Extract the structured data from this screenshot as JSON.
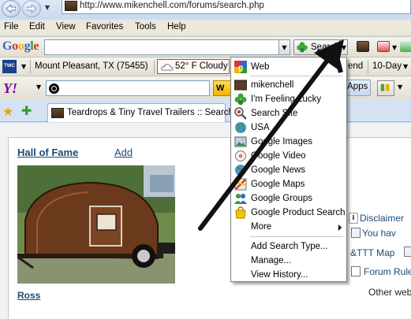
{
  "browser": {
    "address_url": "http://www.mikenchell.com/forums/search.php",
    "menu": [
      "File",
      "Edit",
      "View",
      "Favorites",
      "Tools",
      "Help"
    ]
  },
  "google_toolbar": {
    "logo": "Google",
    "search_button_label": "Search",
    "search_value": ""
  },
  "weather_toolbar": {
    "logo": "TWC",
    "location": "Mount Pleasant, TX (75455)",
    "conditions": "52° F Cloudy",
    "weekend_label": "end",
    "ten_day_label": "10-Day"
  },
  "yahoo_toolbar": {
    "logo": "Y!",
    "web_button": "W",
    "apps_label": "Apps"
  },
  "tab": {
    "title": "Teardrops & Tiny Travel Trailers :: Search"
  },
  "page": {
    "hall_of_fame": "Hall of Fame",
    "add_link": "Add",
    "caption": "Ross",
    "side_links": [
      "Disclaimer",
      "You hav",
      "&TTT Map",
      "Forum Rule"
    ],
    "other_text": "Other web"
  },
  "dropdown": {
    "items": [
      {
        "label": "Web",
        "icon": "google-multicolor-icon"
      },
      {
        "label": "mikenchell",
        "icon": "site-favicon"
      },
      {
        "label": "I'm Feeling Lucky",
        "icon": "clover-icon"
      },
      {
        "label": "Search Site",
        "icon": "search-site-icon"
      },
      {
        "label": "USA",
        "icon": "globe-icon"
      },
      {
        "label": "Google Images",
        "icon": "images-icon"
      },
      {
        "label": "Google Video",
        "icon": "video-icon"
      },
      {
        "label": "Google News",
        "icon": "news-icon"
      },
      {
        "label": "Google Maps",
        "icon": "maps-icon"
      },
      {
        "label": "Google Groups",
        "icon": "groups-icon"
      },
      {
        "label": "Google Product Search",
        "icon": "product-search-icon"
      },
      {
        "label": "More",
        "icon": ""
      }
    ],
    "actions": [
      "Add Search Type...",
      "Manage...",
      "View History..."
    ]
  },
  "colors": {
    "link": "#1d4a78",
    "annotation_arrow": "#111111",
    "weather_border": "#cc4433"
  }
}
